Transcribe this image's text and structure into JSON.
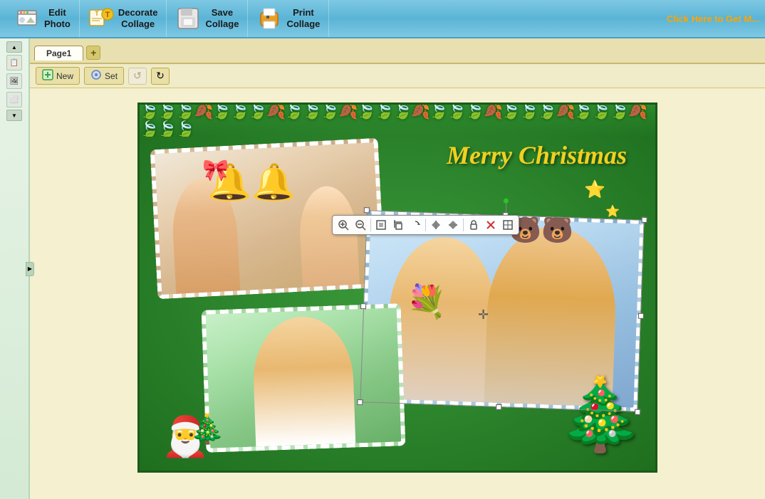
{
  "header": {
    "edit_photo_label": "Edit\nPhoto",
    "decorate_collage_label": "Decorate\nCollage",
    "save_collage_label": "Save\nCollage",
    "print_collage_label": "Print\nCollage",
    "promo_text": "Click Here to Get M..."
  },
  "tabs": {
    "page1_label": "Page1",
    "add_page_label": "+"
  },
  "secondary_toolbar": {
    "new_label": "New",
    "set_label": "Set"
  },
  "collage": {
    "merry_christmas": "Merry Christmas",
    "background_color": "#2d7a2d"
  },
  "photo_edit_tools": {
    "zoom_in": "🔍+",
    "zoom_out": "🔍-",
    "fit": "⊞",
    "crop": "✂",
    "rotate": "↻",
    "flip_h": "⟺",
    "flip_v": "↕",
    "lock": "🔒",
    "close": "✕",
    "expand": "⊡"
  }
}
